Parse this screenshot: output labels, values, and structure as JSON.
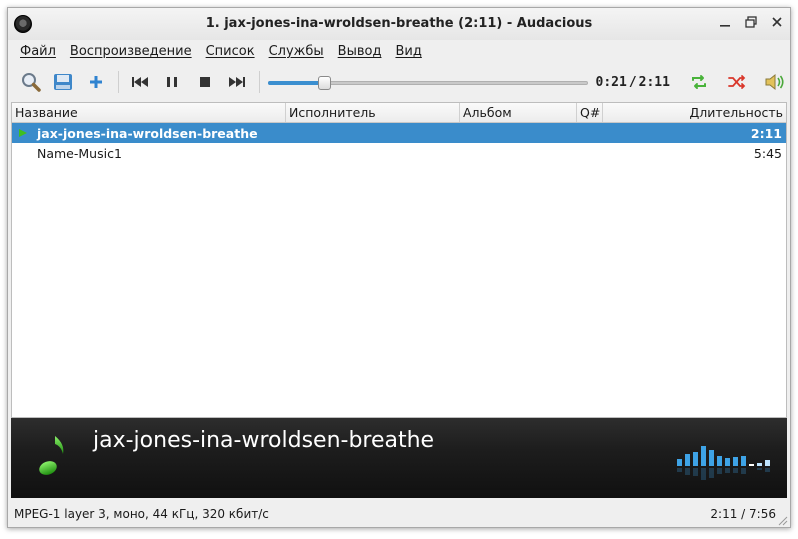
{
  "window": {
    "title": "1. jax-jones-ina-wroldsen-breathe (2:11) - Audacious"
  },
  "menu": [
    "Файл",
    "Воспроизведение",
    "Список",
    "Службы",
    "Вывод",
    "Вид"
  ],
  "toolbar": {
    "elapsed": "0:21",
    "separator": "/",
    "total": "2:11",
    "seek_fraction": 0.16
  },
  "playlist": {
    "columns": [
      "Название",
      "Исполнитель",
      "Альбом",
      "Q#",
      "Длительность"
    ],
    "rows": [
      {
        "title": "jax-jones-ina-wroldsen-breathe",
        "artist": "",
        "album": "",
        "queue": "",
        "length": "2:11",
        "playing": true,
        "selected": true
      },
      {
        "title": "Name-Music1",
        "artist": "",
        "album": "",
        "queue": "",
        "length": "5:45",
        "playing": false,
        "selected": false
      }
    ]
  },
  "now_playing": {
    "title": "jax-jones-ina-wroldsen-breathe"
  },
  "status": {
    "format": "MPEG-1 layer 3, моно, 44 кГц, 320 кбит/с",
    "position": "2:11 / 7:56"
  },
  "colors": {
    "accent": "#3a8ccb",
    "seek_fill": "#3b8fd0",
    "visualizer": "#3ea3e6",
    "infobar_bg": "#1d1d1d",
    "note": "#3fbf1f"
  },
  "visualizer_levels": [
    0.25,
    0.45,
    0.55,
    0.75,
    0.6,
    0.4,
    0.3,
    0.35,
    0.4,
    0,
    0.12,
    0.22
  ]
}
